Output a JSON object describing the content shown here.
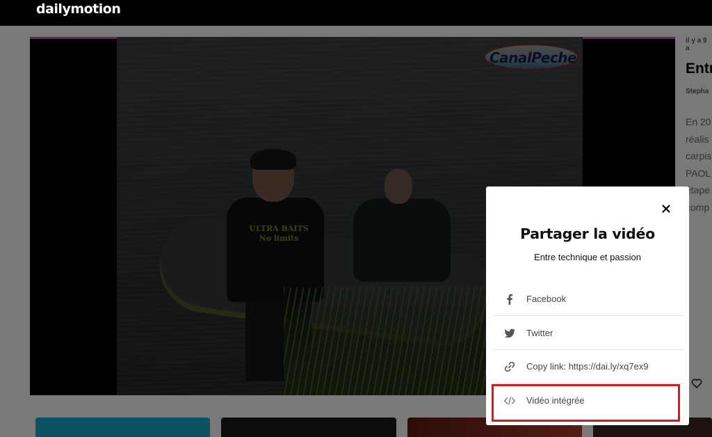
{
  "header": {
    "logo": "dailymotion"
  },
  "video": {
    "channel_logo": "CanalPeche",
    "shirt_line1": "ULTRA BAITS",
    "shirt_line2": "No limits"
  },
  "sidebar": {
    "meta": "il y a 9 a",
    "title": "Entr",
    "author": "Stepha",
    "description_lines": [
      "En 20",
      "réalis",
      "carpis",
      "PAOL",
      "étape",
      "comp"
    ]
  },
  "share_modal": {
    "title": "Partager la vidéo",
    "subtitle": "Entre technique et passion",
    "options": [
      {
        "label": "Facebook",
        "icon": "facebook-icon"
      },
      {
        "label": "Twitter",
        "icon": "twitter-icon"
      },
      {
        "label": "Copy link: https://dai.ly/xq7ex9",
        "icon": "link-icon"
      },
      {
        "label": "Vidéo intégrée",
        "icon": "embed-code-icon"
      }
    ]
  },
  "colors": {
    "highlight": "#d11a1a",
    "player_topline": "#c64ab0",
    "thumb_teal": "#1aa3c8"
  }
}
